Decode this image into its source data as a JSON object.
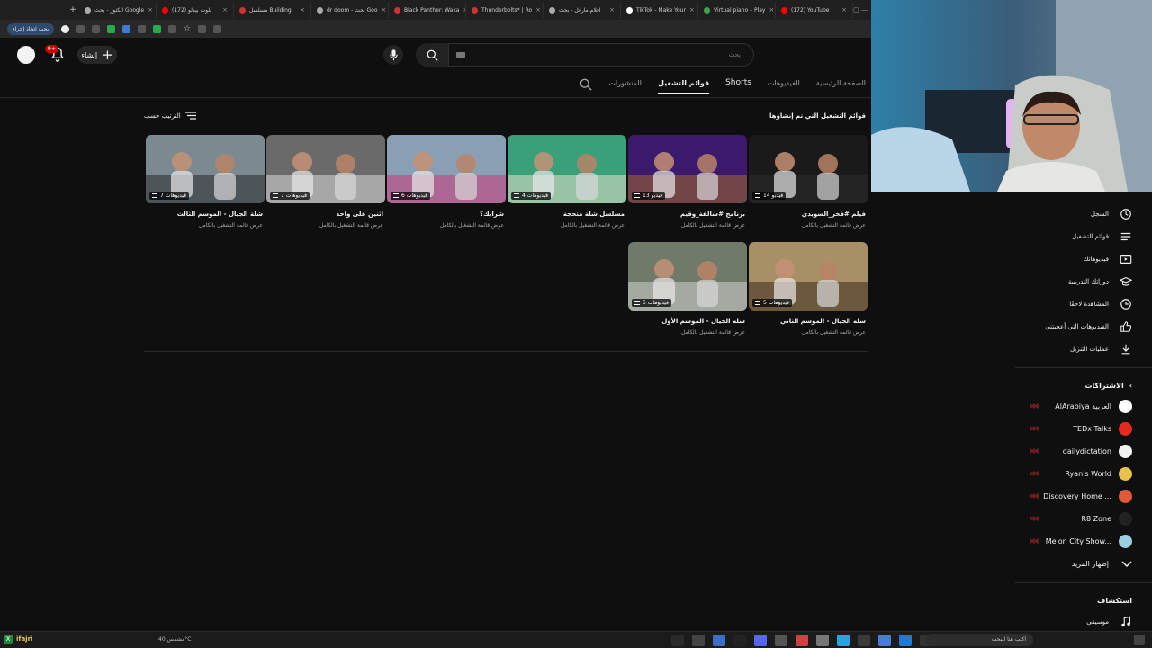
{
  "browser": {
    "tabs": [
      {
        "title": "(172) YouTube",
        "color": "#ff0000"
      },
      {
        "title": "Virtual piano – Play",
        "color": "#3fa34d"
      },
      {
        "title": "TikTok - Make Your",
        "color": "#ffffff"
      },
      {
        "title": "افلام مارفل - بحث",
        "color": "#aaaaaa"
      },
      {
        "title": "Thunderbolts* | Ro",
        "color": "#cc3333"
      },
      {
        "title": "Black Panther: Waka",
        "color": "#cc3333"
      },
      {
        "title": "dr doom - بحث Goo",
        "color": "#aaaaaa"
      },
      {
        "title": "مسلسل Building",
        "color": "#cc3333"
      },
      {
        "title": "(172) بلوت بيدلو",
        "color": "#ff0000"
      },
      {
        "title": "الكثور - بحث Google",
        "color": "#aaaaaa"
      }
    ],
    "install_label": "يجب اتخاذ إجراء"
  },
  "header": {
    "create_label": "إنشاء",
    "notifications_count": "9+",
    "search_placeholder": "بحث"
  },
  "channel_tabs": [
    {
      "label": "الصفحة الرئيسية",
      "active": false
    },
    {
      "label": "الفيديوهات",
      "active": false
    },
    {
      "label": "Shorts",
      "active": false
    },
    {
      "label": "قوائم التشغيل",
      "active": true
    },
    {
      "label": "المنشورات",
      "active": false
    }
  ],
  "section": {
    "title": "قوائم التشغيل التي تم إنشاؤها",
    "sort_label": "الترتيب حسب"
  },
  "playlists": [
    {
      "title": "فيلم #فخر_السويدي",
      "count": "14 فيديو",
      "subtitle": "عرض قائمة التشغيل بالكامل",
      "color": "#1a1a1a",
      "accent": "#2d2d2d"
    },
    {
      "title": "برنامج #سالفة_وقيم",
      "count": "13 فيديو",
      "subtitle": "عرض قائمة التشغيل بالكامل",
      "color": "#3b1a6e",
      "accent": "#a06a2a"
    },
    {
      "title": "مسلسل شلة متحجة",
      "count": "4 فيديوهات",
      "subtitle": "عرض قائمة التشغيل بالكامل",
      "color": "#3aa07a",
      "accent": "#e5e0c8"
    },
    {
      "title": "شرايك؟",
      "count": "6 فيديوهات",
      "subtitle": "عرض قائمة التشغيل بالكامل",
      "color": "#8a9fb3",
      "accent": "#c93a78"
    },
    {
      "title": "اثنين على واحد",
      "count": "7 فيديوهات",
      "subtitle": "عرض قائمة التشغيل بالكامل",
      "color": "#6a6a6a",
      "accent": "#d8d8d8"
    },
    {
      "title": "شلة الجيال - الموسم الثالث",
      "count": "7 فيديوهات",
      "subtitle": "عرض قائمة التشغيل بالكامل",
      "color": "#7b8a90",
      "accent": "#2a2a2a"
    },
    {
      "title": "شلة الجيال - الموسم الثاني",
      "count": "5 فيديوهات",
      "subtitle": "عرض قائمة التشغيل بالكامل",
      "color": "#a89066",
      "accent": "#3a2a1a"
    },
    {
      "title": "شلة الجيال - الموسم الأول",
      "count": "5 فيديوهات",
      "subtitle": "عرض قائمة التشغيل بالكامل",
      "color": "#6f7a6a",
      "accent": "#d0d0d0"
    }
  ],
  "sidebar": {
    "you_items": [
      {
        "label": "السجل",
        "icon": "history-icon"
      },
      {
        "label": "قوائم التشغيل",
        "icon": "playlists-icon"
      },
      {
        "label": "فيديوهاتك",
        "icon": "your-videos-icon"
      },
      {
        "label": "دوراتك التدريبية",
        "icon": "courses-icon"
      },
      {
        "label": "المشاهدة لاحقًا",
        "icon": "watch-later-icon"
      },
      {
        "label": "الفيديوهات التي أعجبتني",
        "icon": "liked-icon"
      },
      {
        "label": "عمليات التنزيل",
        "icon": "download-icon"
      }
    ],
    "subscriptions_heading": "الاشتراكات",
    "subscriptions": [
      {
        "label": "AlArabiya العربية",
        "color": "#ffffff"
      },
      {
        "label": "TEDx Talks",
        "color": "#e62b1e"
      },
      {
        "label": "dailydictation",
        "color": "#f2f2f2"
      },
      {
        "label": "Ryan's World",
        "color": "#e8c24a"
      },
      {
        "label": "Discovery Home ...",
        "color": "#e05a3a"
      },
      {
        "label": "R8 Zone",
        "color": "#222222"
      },
      {
        "label": "Melon City Show...",
        "color": "#9ad0e0"
      }
    ],
    "show_more": "إظهار المزيد",
    "explore_heading": "استكشاف",
    "explore_items": [
      {
        "label": "موسيقى",
        "icon": "music-icon"
      }
    ]
  },
  "taskbar": {
    "search_placeholder": "اكتب هنا للبحث",
    "left_text": "ifajri",
    "weather": "مشمس 40°C"
  }
}
